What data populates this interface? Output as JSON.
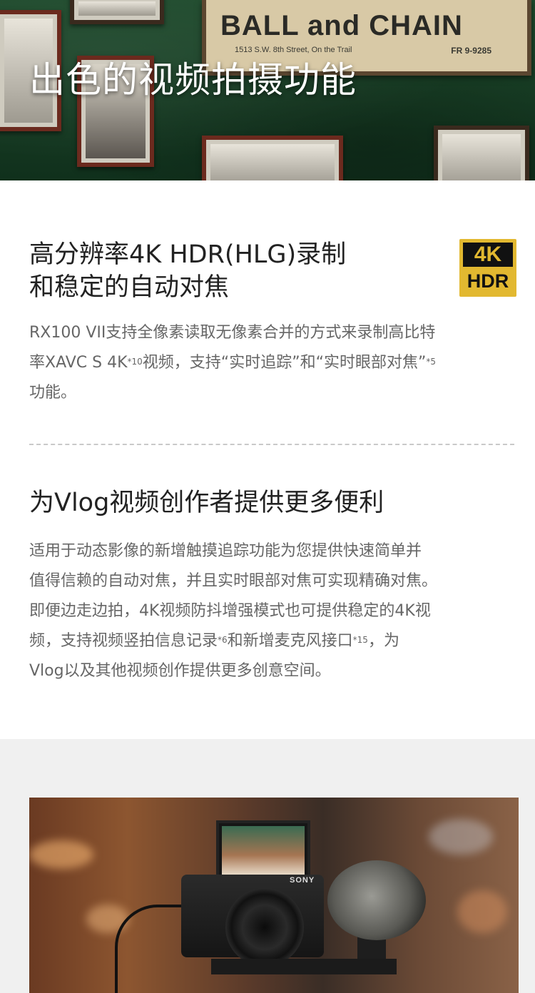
{
  "hero": {
    "title": "出色的视频拍摄功能",
    "sign_title": "BALL and CHAIN",
    "sign_address": "1513 S.W. 8th Street, On the Trail",
    "sign_phone": "FR 9-9285"
  },
  "section1": {
    "heading_line1": "高分辨率4K HDR(HLG)录制",
    "heading_line2": "和稳定的自动对焦",
    "badge_top": "4K",
    "badge_bottom": "HDR",
    "para_a": "RX100 VII支持全像素读取无像素合并的方式来录制高比特",
    "para_b": "率XAVC S 4K",
    "sup1": "*10",
    "para_c": "视频，支持“实时追踪”和“实时眼部对焦”",
    "sup2": "*5",
    "para_d": "功能。"
  },
  "section2": {
    "heading": "为Vlog视频创作者提供更多便利",
    "line1": "适用于动态影像的新增触摸追踪功能为您提供快速简单并",
    "line2": "值得信赖的自动对焦，并且实时眼部对焦可实现精确对焦。",
    "line3": "即便边走边拍，4K视频防抖增强模式也可提供稳定的4K视",
    "line4a": "频，支持视频竖拍信息记录",
    "sup1": "*6",
    "line4b": "和新增麦克风接口",
    "sup2": "*15",
    "line4c": "，为",
    "line5": "Vlog以及其他视频创作提供更多创意空间。"
  },
  "photo": {
    "camera_brand": "SONY"
  }
}
